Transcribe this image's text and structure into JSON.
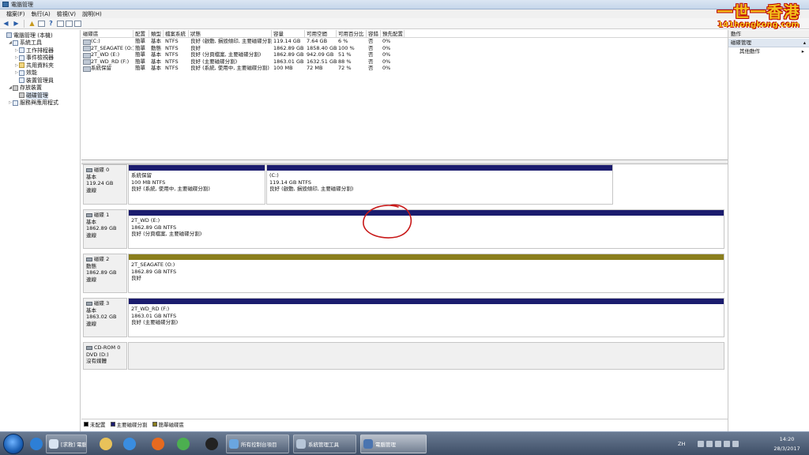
{
  "window": {
    "title": "電腦管理"
  },
  "watermark": {
    "line1": "一世一香港",
    "line2": "141hongkong.com"
  },
  "menu": [
    "檔案(F)",
    "執行(A)",
    "檢視(V)",
    "說明(H)"
  ],
  "tree": [
    {
      "label": "電腦管理 (本機)",
      "level": 0,
      "expander": "",
      "icon": "computer-icon"
    },
    {
      "label": "系統工具",
      "level": 1,
      "expander": "◢",
      "icon": "tools-icon"
    },
    {
      "label": "工作排程器",
      "level": 2,
      "expander": "▷",
      "icon": "task-scheduler-icon"
    },
    {
      "label": "事件檢視器",
      "level": 2,
      "expander": "▷",
      "icon": "event-viewer-icon"
    },
    {
      "label": "共用資料夾",
      "level": 2,
      "expander": "▷",
      "icon": "shared-folder-icon"
    },
    {
      "label": "效能",
      "level": 2,
      "expander": "▷",
      "icon": "performance-icon"
    },
    {
      "label": "裝置管理員",
      "level": 2,
      "expander": "",
      "icon": "device-manager-icon"
    },
    {
      "label": "存放裝置",
      "level": 1,
      "expander": "◢",
      "icon": "storage-icon"
    },
    {
      "label": "磁碟管理",
      "level": 2,
      "expander": "",
      "icon": "disk-management-icon",
      "selected": true
    },
    {
      "label": "服務與應用程式",
      "level": 1,
      "expander": "▷",
      "icon": "services-icon"
    }
  ],
  "volume_table": {
    "headers": [
      "磁碟區",
      "配置",
      "類型",
      "檔案系統",
      "狀態",
      "容量",
      "可用空間",
      "可用百分比",
      "容錯",
      "預先配置"
    ],
    "rows": [
      [
        "(C:)",
        "簡單",
        "基本",
        "NTFS",
        "良好 (啟動, 損毀傾印, 主要磁碟分割)",
        "119.14 GB",
        "7.64 GB",
        "6 %",
        "否",
        "0%"
      ],
      [
        "2T_SEAGATE (O:)",
        "簡單",
        "動態",
        "NTFS",
        "良好",
        "1862.89 GB",
        "1858.40 GB",
        "100 %",
        "否",
        "0%"
      ],
      [
        "2T_WD (E:)",
        "簡單",
        "基本",
        "NTFS",
        "良好 (分頁檔案, 主要磁碟分割)",
        "1862.89 GB",
        "942.09 GB",
        "51 %",
        "否",
        "0%"
      ],
      [
        "2T_WD_RD (F:)",
        "簡單",
        "基本",
        "NTFS",
        "良好 (主要磁碟分割)",
        "1863.01 GB",
        "1632.51 GB",
        "88 %",
        "否",
        "0%"
      ],
      [
        "系統保留",
        "簡單",
        "基本",
        "NTFS",
        "良好 (系統, 使用中, 主要磁碟分割)",
        "100 MB",
        "72 MB",
        "72 %",
        "否",
        "0%"
      ]
    ]
  },
  "disks": [
    {
      "name": "磁碟 0",
      "type": "基本",
      "size": "119.24 GB",
      "status": "連線",
      "partitions": [
        {
          "title": "系統保留",
          "size": "100 MB NTFS",
          "status": "良好 (系統, 使用中, 主要磁碟分割)",
          "bar": "primary"
        },
        {
          "title": "(C:)",
          "size": "119.14 GB NTFS",
          "status": "良好 (啟動, 損毀傾印, 主要磁碟分割)",
          "bar": "primary"
        }
      ]
    },
    {
      "name": "磁碟 1",
      "type": "基本",
      "size": "1862.89 GB",
      "status": "連線",
      "partitions": [
        {
          "title": "2T_WD (E:)",
          "size": "1862.89 GB NTFS",
          "status": "良好 (分頁檔案, 主要磁碟分割)",
          "bar": "primary"
        }
      ]
    },
    {
      "name": "磁碟 2",
      "type": "動態",
      "size": "1862.89 GB",
      "status": "連線",
      "partitions": [
        {
          "title": "2T_SEAGATE (O:)",
          "size": "1862.89 GB NTFS",
          "status": "良好",
          "bar": "simple"
        }
      ]
    },
    {
      "name": "磁碟 3",
      "type": "基本",
      "size": "1863.02 GB",
      "status": "連線",
      "partitions": [
        {
          "title": "2T_WD_RD (F:)",
          "size": "1863.01 GB NTFS",
          "status": "良好 (主要磁碟分割)",
          "bar": "primary"
        }
      ]
    },
    {
      "name": "CD-ROM 0",
      "type": "DVD (D:)",
      "size": "",
      "status": "沒有媒體",
      "partitions": []
    }
  ],
  "legend": [
    {
      "label": "未配置",
      "color": "#000000"
    },
    {
      "label": "主要磁碟分割",
      "color": "#1b1c6e"
    },
    {
      "label": "簡單磁碟區",
      "color": "#8a7e1d"
    }
  ],
  "actions": {
    "header": "動作",
    "section": "磁碟管理",
    "item": "其他動作"
  },
  "taskbar": {
    "items": [
      {
        "label": "",
        "kind": "pinned",
        "icon": "internet-explorer-icon",
        "color": "#2d7fd6"
      },
      {
        "label": "[求救] 電腦問題電...",
        "kind": "win",
        "icon": "browser-window-icon",
        "color": "#d8e4f2"
      },
      {
        "label": "",
        "kind": "pinned",
        "icon": "explorer-folder-icon",
        "color": "#e8c25a"
      },
      {
        "label": "",
        "kind": "pinned",
        "icon": "media-player-icon",
        "color": "#3a8de0"
      },
      {
        "label": "",
        "kind": "pinned",
        "icon": "firefox-icon",
        "color": "#e66a1f"
      },
      {
        "label": "",
        "kind": "pinned",
        "icon": "chrome-icon",
        "color": "#4caf50"
      },
      {
        "label": "",
        "kind": "pinned",
        "icon": "media-app-icon",
        "color": "#222222"
      },
      {
        "label": "所有控制台項目",
        "kind": "win",
        "icon": "control-panel-icon",
        "color": "#6aa6e0"
      },
      {
        "label": "系統管理工具",
        "kind": "win",
        "icon": "admin-tools-icon",
        "color": "#b7c6d8"
      },
      {
        "label": "電腦管理",
        "kind": "win active",
        "icon": "computer-management-icon",
        "color": "#4a74b0"
      }
    ],
    "lang": "ZH",
    "time": "14:20",
    "date": "28/3/2017"
  }
}
